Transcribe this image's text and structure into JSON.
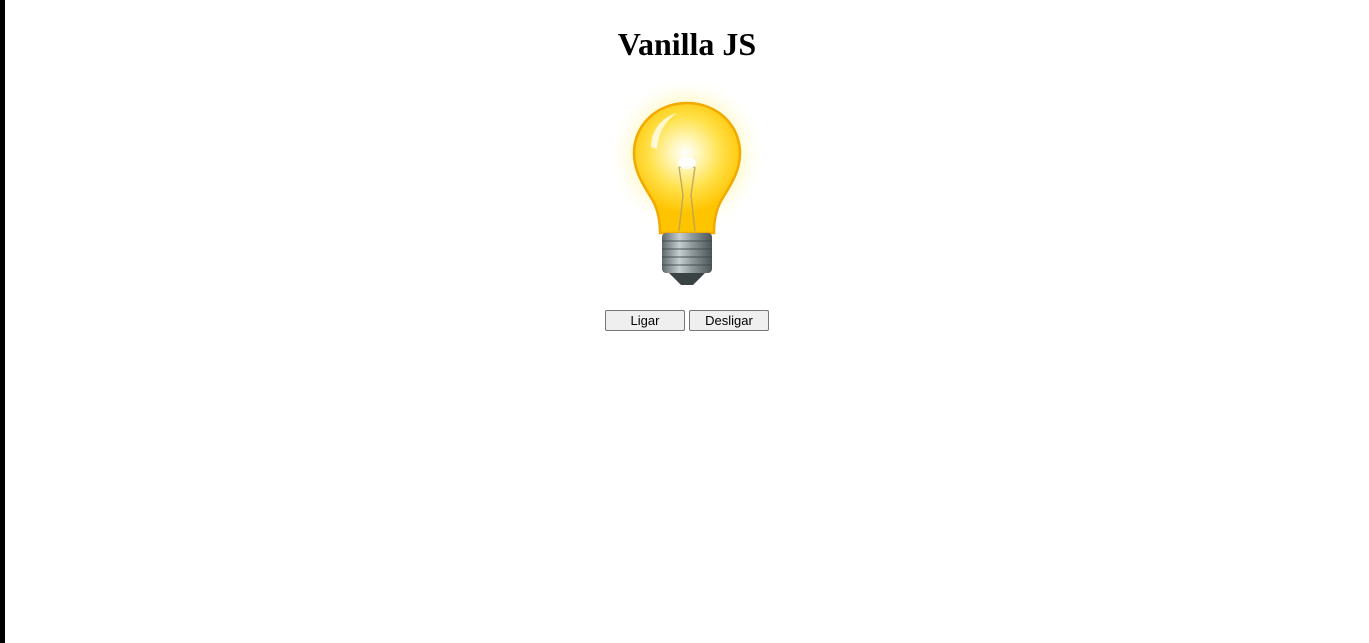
{
  "page": {
    "title": "Vanilla JS"
  },
  "lamp": {
    "state": "on",
    "icon": "lightbulb-icon"
  },
  "controls": {
    "on_label": "Ligar",
    "off_label": "Desligar"
  },
  "colors": {
    "glow": "#fff59a",
    "bulb": "#ffd400",
    "bulb_edge": "#f2a900",
    "base": "#8a9496"
  }
}
